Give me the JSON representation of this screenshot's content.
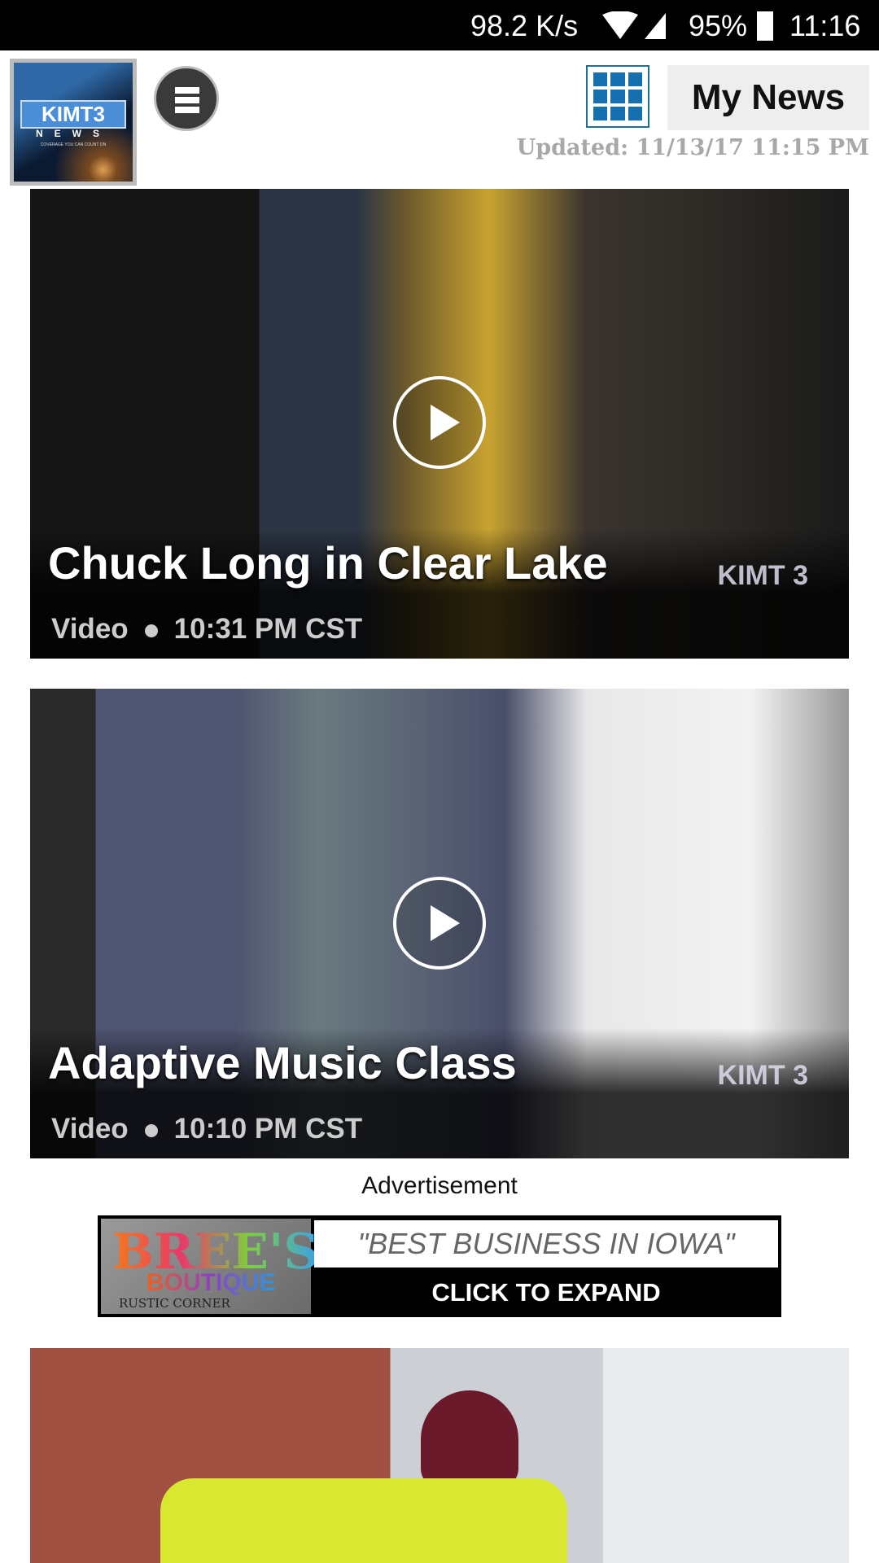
{
  "status_bar": {
    "speed": "98.2 K/s",
    "battery": "95%",
    "time": "11:16"
  },
  "header": {
    "logo_text": "KIMT3",
    "logo_sub": "NEWS",
    "logo_tagline": "COVERAGE YOU CAN COUNT ON",
    "my_news_label": "My News",
    "updated": "Updated: 11/13/17 11:15 PM",
    "accent": "#1670b0"
  },
  "stories": [
    {
      "title": "Chuck Long in Clear Lake",
      "type": "Video",
      "time": "10:31 PM CST",
      "bug": "KIMT 3"
    },
    {
      "title": "Adaptive Music Class",
      "type": "Video",
      "time": "10:10 PM CST",
      "bug": "KIMT 3"
    }
  ],
  "ad": {
    "label": "Advertisement",
    "brand": "BREE'S",
    "brand2": "BOUTIQUE",
    "brand3": "RUSTIC CORNER",
    "slogan": "\"BEST BUSINESS IN IOWA\"",
    "cta": "CLICK TO EXPAND"
  }
}
